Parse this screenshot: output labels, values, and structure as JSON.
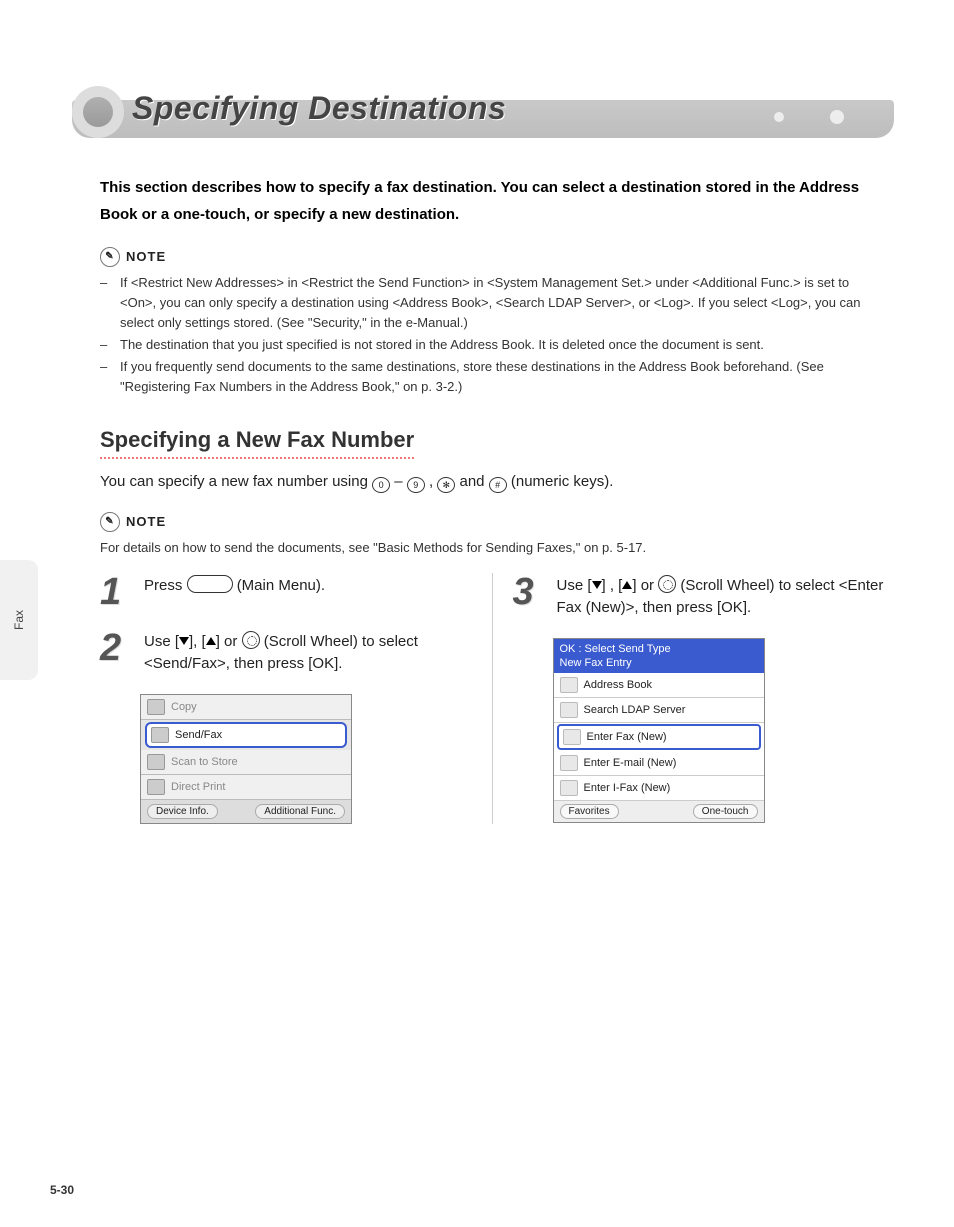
{
  "sideTab": "Fax",
  "pageNumber": "5-30",
  "banner": {
    "title": "Specifying Destinations"
  },
  "intro": "This section describes how to specify a fax destination. You can select a destination stored in the Address Book or a one-touch, or specify a new destination.",
  "note1": {
    "label": "NOTE",
    "items": [
      "If <Restrict New Addresses> in <Restrict the Send Function> in <System Management Set.> under <Additional Func.> is set to <On>, you can only specify a destination using <Address Book>, <Search LDAP Server>, or <Log>. If you select <Log>, you can select only settings stored. (See \"Security,\" in the e-Manual.)",
      "The destination that you just specified is not stored in the Address Book. It is deleted once the document is sent.",
      "If you frequently send documents to the same destinations, store these destinations in the Address Book beforehand. (See \"Registering Fax Numbers in the Address Book,\" on p. 3-2.)"
    ]
  },
  "subheading": "Specifying a New Fax Number",
  "subIntro": {
    "prefix": "You can specify a new fax number using ",
    "k0": "0",
    "dash": "–",
    "k9": "9",
    "comma1": ", ",
    "kStar": "✻",
    "and": " and ",
    "kHash": "#",
    "suffix": " (numeric keys)."
  },
  "note2": {
    "label": "NOTE",
    "text": "For details on how to send the documents, see \"Basic Methods for Sending Faxes,\" on p. 5-17."
  },
  "steps": {
    "s1": {
      "num": "1",
      "text_a": "Press ",
      "text_b": " (Main Menu)."
    },
    "s2": {
      "num": "2",
      "text_a": "Use [",
      "text_b": "], [",
      "text_c": "] or ",
      "text_d": " (Scroll Wheel) to select <Send/Fax>, then press [OK]."
    },
    "s3": {
      "num": "3",
      "text_a": "Use [",
      "text_b": "] , [",
      "text_c": "] or ",
      "text_d": " (Scroll Wheel) to select <Enter Fax (New)>, then press [OK]."
    }
  },
  "screen1": {
    "rows": [
      "Copy",
      "Send/Fax",
      "Scan to Store",
      "Direct Print"
    ],
    "selectedIndex": 1,
    "footer": [
      "Device Info.",
      "Additional Func."
    ]
  },
  "screen2": {
    "headerLine1": "OK : Select Send Type",
    "headerLine2": "New Fax Entry",
    "rows": [
      "Address Book",
      "Search LDAP Server",
      "Enter Fax (New)",
      "Enter E-mail (New)",
      "Enter I-Fax (New)"
    ],
    "selectedIndex": 2,
    "footer": [
      "Favorites",
      "One-touch"
    ]
  }
}
